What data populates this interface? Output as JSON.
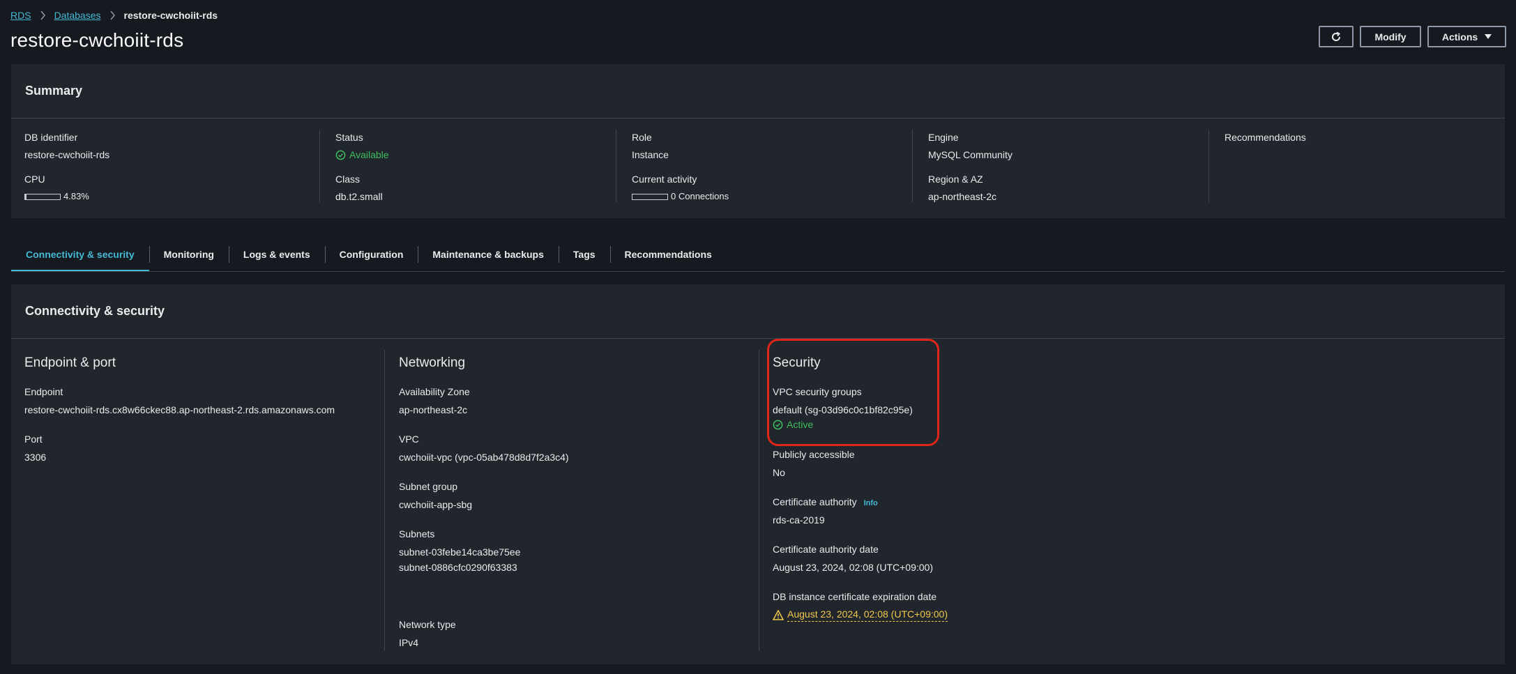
{
  "breadcrumb": {
    "items": [
      "RDS",
      "Databases"
    ],
    "current": "restore-cwchoiit-rds"
  },
  "header": {
    "title": "restore-cwchoiit-rds",
    "modify_label": "Modify",
    "actions_label": "Actions"
  },
  "summary": {
    "title": "Summary",
    "db_identifier": {
      "label": "DB identifier",
      "value": "restore-cwchoiit-rds"
    },
    "cpu": {
      "label": "CPU",
      "value": "4.83%",
      "fraction": 0.0483
    },
    "status": {
      "label": "Status",
      "value": "Available"
    },
    "class": {
      "label": "Class",
      "value": "db.t2.small"
    },
    "role": {
      "label": "Role",
      "value": "Instance"
    },
    "current_activity": {
      "label": "Current activity",
      "value": "0 Connections"
    },
    "engine": {
      "label": "Engine",
      "value": "MySQL Community"
    },
    "region": {
      "label": "Region & AZ",
      "value": "ap-northeast-2c"
    },
    "recommendations": {
      "label": "Recommendations"
    }
  },
  "tabs": [
    {
      "label": "Connectivity & security",
      "active": true
    },
    {
      "label": "Monitoring"
    },
    {
      "label": "Logs & events"
    },
    {
      "label": "Configuration"
    },
    {
      "label": "Maintenance & backups"
    },
    {
      "label": "Tags"
    },
    {
      "label": "Recommendations"
    }
  ],
  "connectivity": {
    "title": "Connectivity & security",
    "endpoint_port": {
      "heading": "Endpoint & port",
      "endpoint_label": "Endpoint",
      "endpoint_value": "restore-cwchoiit-rds.cx8w66ckec88.ap-northeast-2.rds.amazonaws.com",
      "port_label": "Port",
      "port_value": "3306"
    },
    "networking": {
      "heading": "Networking",
      "az_label": "Availability Zone",
      "az_value": "ap-northeast-2c",
      "vpc_label": "VPC",
      "vpc_value": "cwchoiit-vpc (vpc-05ab478d8d7f2a3c4)",
      "subnet_group_label": "Subnet group",
      "subnet_group_value": "cwchoiit-app-sbg",
      "subnets_label": "Subnets",
      "subnets": [
        "subnet-03febe14ca3be75ee",
        "subnet-0886cfc0290f63383"
      ],
      "network_type_label": "Network type",
      "network_type_value": "IPv4"
    },
    "security": {
      "heading": "Security",
      "vpc_sg_label": "VPC security groups",
      "vpc_sg_value": "default (sg-03d96c0c1bf82c95e)",
      "vpc_sg_status": "Active",
      "public_label": "Publicly accessible",
      "public_value": "No",
      "ca_label": "Certificate authority",
      "ca_info": "Info",
      "ca_value": "rds-ca-2019",
      "ca_date_label": "Certificate authority date",
      "ca_date_value": "August 23, 2024, 02:08 (UTC+09:00)",
      "expiry_label": "DB instance certificate expiration date",
      "expiry_value": "August 23, 2024, 02:08 (UTC+09:00)"
    }
  },
  "colors": {
    "background": "#16191f",
    "panel": "#21252c",
    "accent": "#44b9d6",
    "success": "#3fbf5f",
    "warning": "#f2c94c",
    "highlight": "#e0251a"
  }
}
